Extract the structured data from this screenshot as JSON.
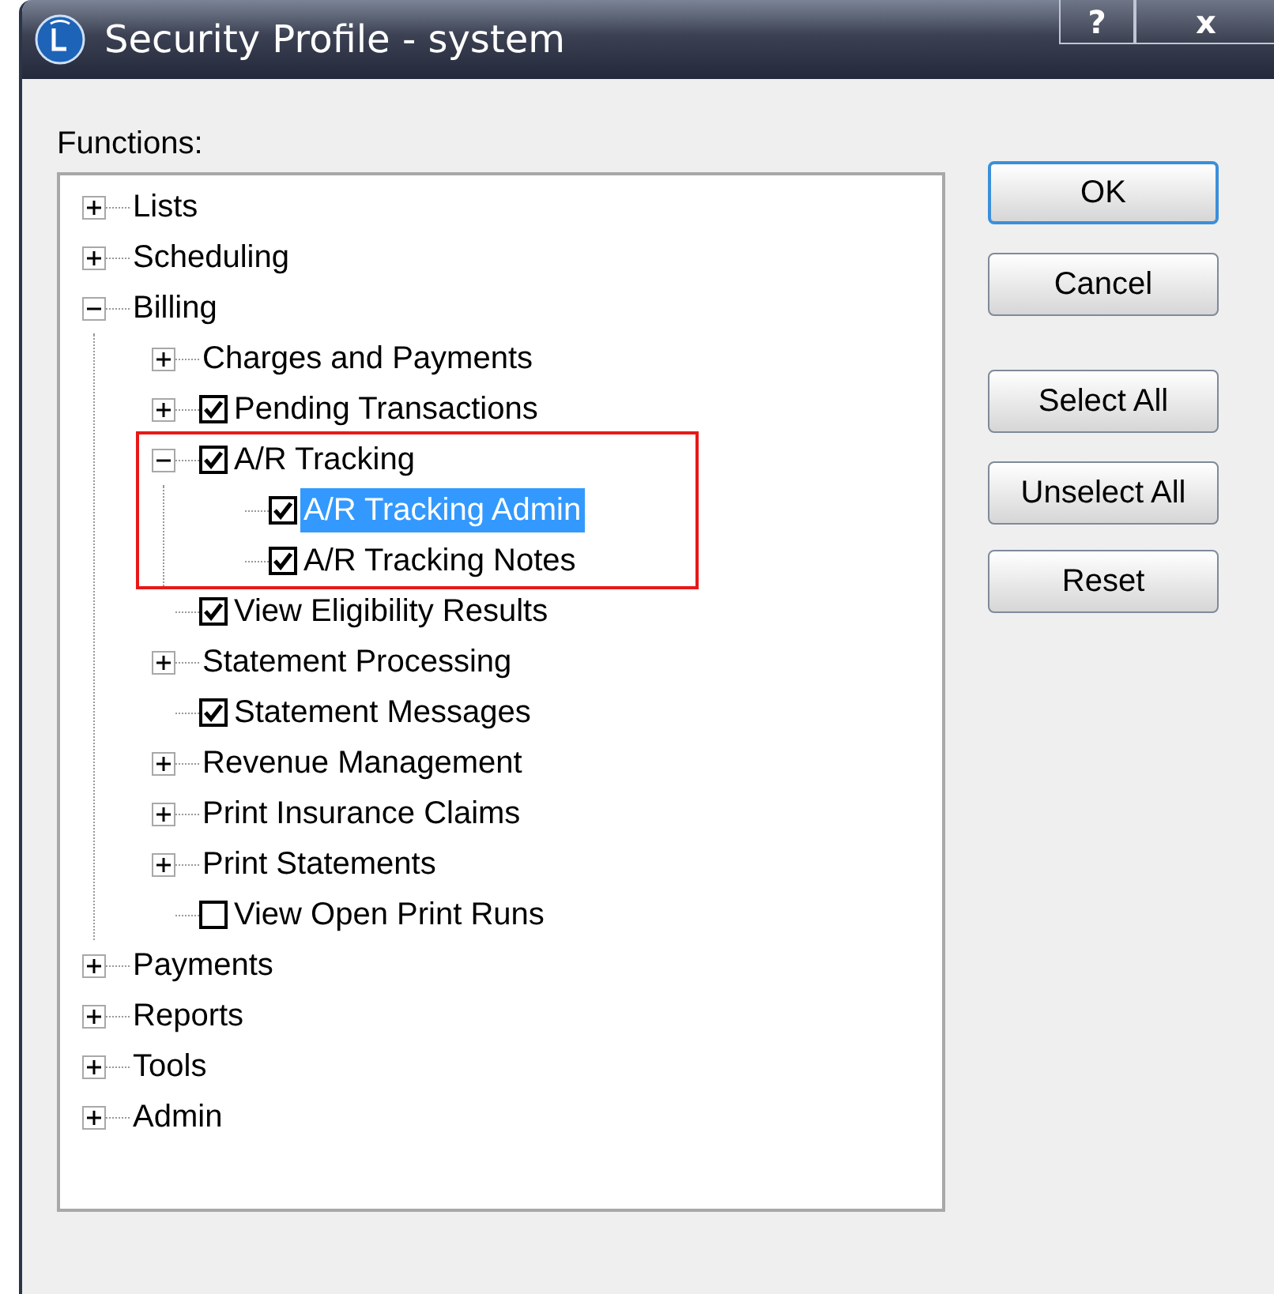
{
  "window": {
    "title": "Security Profile - system",
    "controls": [
      "?",
      "x"
    ]
  },
  "functions_label": "Functions:",
  "tree": [
    {
      "label": "Lists",
      "expanded": false,
      "selected": false
    },
    {
      "label": "Scheduling",
      "expanded": false,
      "selected": false
    },
    {
      "label": "Billing",
      "expanded": true,
      "selected": false,
      "children": [
        {
          "label": "Charges and Payments",
          "expanded": false,
          "selected": false
        },
        {
          "label": "Pending Transactions",
          "expanded": false,
          "checked": true,
          "selected": false
        },
        {
          "label": "A/R Tracking",
          "expanded": true,
          "checked": true,
          "selected": false,
          "annotated": true,
          "children": [
            {
              "label": "A/R Tracking Admin",
              "checked": true,
              "selected": true
            },
            {
              "label": "A/R Tracking Notes",
              "checked": true,
              "selected": false
            }
          ]
        },
        {
          "label": "View Eligibility Results",
          "checked": true,
          "selected": false
        },
        {
          "label": "Statement Processing",
          "expanded": false,
          "selected": false
        },
        {
          "label": "Statement Messages",
          "checked": true,
          "selected": false
        },
        {
          "label": "Revenue Management",
          "expanded": false,
          "selected": false
        },
        {
          "label": "Print Insurance Claims",
          "expanded": false,
          "selected": false
        },
        {
          "label": "Print Statements",
          "expanded": false,
          "selected": false
        },
        {
          "label": "View Open Print Runs",
          "checked": false,
          "selected": false
        }
      ]
    },
    {
      "label": "Payments",
      "expanded": false,
      "selected": false
    },
    {
      "label": "Reports",
      "expanded": false,
      "selected": false
    },
    {
      "label": "Tools",
      "expanded": false,
      "selected": false
    },
    {
      "label": "Admin",
      "expanded": false,
      "selected": false
    }
  ],
  "buttons": [
    {
      "label": "OK",
      "default": true
    },
    {
      "label": "Cancel",
      "default": false
    },
    {
      "label": "Select All",
      "default": false
    },
    {
      "label": "Unselect All",
      "default": false
    },
    {
      "label": "Reset",
      "default": false
    }
  ]
}
